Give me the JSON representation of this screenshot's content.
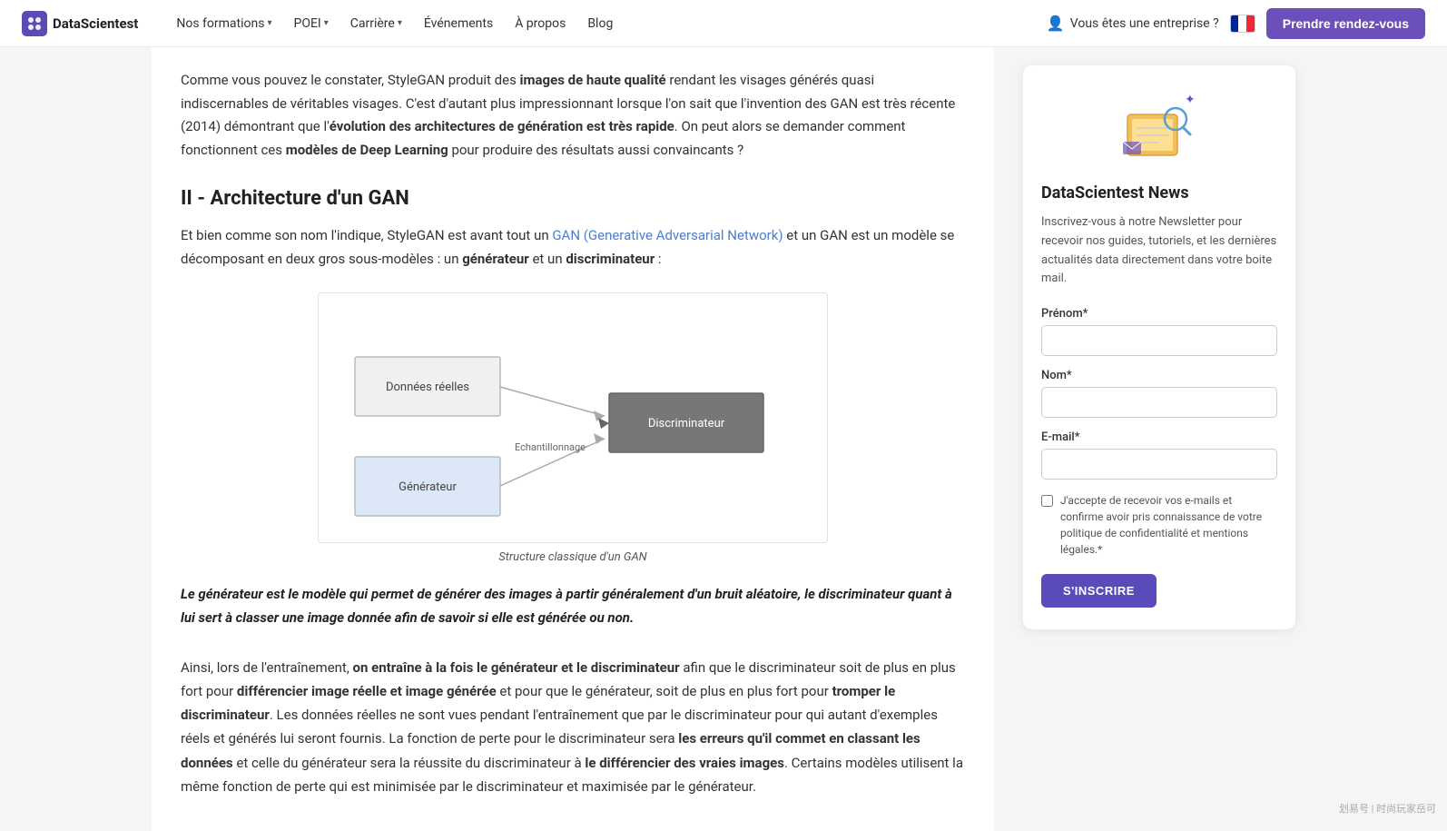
{
  "navbar": {
    "logo_text": "DataScientest",
    "nav_items": [
      {
        "label": "Nos formations",
        "has_chevron": true
      },
      {
        "label": "POEI",
        "has_chevron": true
      },
      {
        "label": "Carrière",
        "has_chevron": true
      },
      {
        "label": "Événements",
        "has_chevron": false
      },
      {
        "label": "À propos",
        "has_chevron": false
      },
      {
        "label": "Blog",
        "has_chevron": false
      }
    ],
    "enterprise_label": "Vous êtes une entreprise ?",
    "cta_label": "Prendre rendez-vous"
  },
  "article": {
    "intro_paragraph": "Comme vous pouvez le constater, StyleGAN produit des images de haute qualité rendant les visages générés quasi indiscernables de véritables visages. C'est d'autant plus impressionnant lorsque l'on sait que l'invention des GAN est très récente (2014) démontrant que l'évolution des architectures de génération est très rapide. On peut alors se demander comment fonctionnent ces modèles de Deep Learning pour produire des résultats aussi convaincants ?",
    "section_title": "II - Architecture d'un GAN",
    "section_paragraph": "Et bien comme son nom l'indique, StyleGAN est avant tout un GAN (Generative Adversarial Network) et un GAN est un modèle se décomposant en deux gros sous-modèles : un générateur et un discriminateur :",
    "diagram_caption": "Structure classique d'un GAN",
    "gan_link_text": "GAN (Generative Adversarial Network)",
    "quote_text": "Le générateur est le modèle qui permet de générer des images à partir généralement d'un bruit aléatoire, le discriminateur quant à lui sert à classer une image donnée afin de savoir si elle est générée ou non.",
    "body_paragraph": "Ainsi, lors de l'entraînement, on entraîne à la fois le générateur et le discriminateur afin que le discriminateur soit de plus en plus fort pour différencier image réelle et image générée et pour que le générateur, soit de plus en plus fort pour tromper le discriminateur. Les données réelles ne sont vues pendant l'entraînement que par le discriminateur pour qui autant d'exemples réels et générés lui seront fournis. La fonction de perte pour le discriminateur sera les erreurs qu'il commet en classant les données et celle du générateur sera la réussite du discriminateur à le différencier des vraies images. Certains modèles utilisent la même fonction de perte qui est minimisée par le discriminateur et maximisée par le générateur.",
    "diagram": {
      "node_donnees": "Données réelles",
      "node_discriminateur": "Discriminateur",
      "node_generateur": "Générateur",
      "label_echantillonnage": "Echantillonnage"
    }
  },
  "sidebar": {
    "title": "DataScientest News",
    "description": "Inscrivez-vous à notre Newsletter pour recevoir nos guides, tutoriels, et les dernières actualités data directement dans votre boite mail.",
    "form": {
      "prenom_label": "Prénom*",
      "prenom_placeholder": "",
      "nom_label": "Nom*",
      "nom_placeholder": "",
      "email_label": "E-mail*",
      "email_placeholder": "",
      "checkbox_label": "J'accepte de recevoir vos e-mails et confirme avoir pris connaissance de votre politique de confidentialité et mentions légales.*",
      "submit_label": "S'INSCRIRE"
    }
  },
  "watermark": "划易号 | 时尚玩家岳可"
}
